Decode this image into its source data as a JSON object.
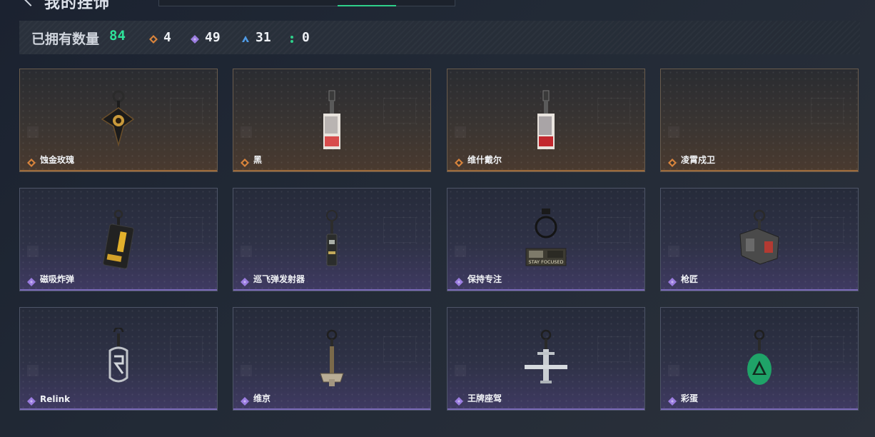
{
  "header": {
    "title": "我的挂饰"
  },
  "summary": {
    "owned_label": "已拥有数量",
    "owned_total": "84",
    "stats": [
      {
        "icon": "orange-diamond-icon",
        "color": "#d9843c",
        "count": "4"
      },
      {
        "icon": "purple-diamond-icon",
        "color": "#9b7de0",
        "count": "49"
      },
      {
        "icon": "blue-triangle-icon",
        "color": "#4f9be6",
        "count": "31"
      },
      {
        "icon": "green-dots-icon",
        "color": "#2fd08a",
        "count": "0"
      }
    ]
  },
  "colors": {
    "accent_green": "#2fd08a",
    "rarity_orange": "#d9843c",
    "rarity_purple": "#9b7de0"
  },
  "items": [
    {
      "name": "蚀金玫瑰",
      "rarity": "orange",
      "icon": "gold-rose-charm-icon"
    },
    {
      "name": "黑",
      "rarity": "orange",
      "icon": "black-card-charm-icon"
    },
    {
      "name": "维什戴尔",
      "rarity": "orange",
      "icon": "wisadel-card-charm-icon"
    },
    {
      "name": "凌霄戍卫",
      "rarity": "orange",
      "icon": "empty-slot-icon"
    },
    {
      "name": "磁吸炸弹",
      "rarity": "purple",
      "icon": "magnetic-bomb-charm-icon"
    },
    {
      "name": "巡飞弹发射器",
      "rarity": "purple",
      "icon": "loitering-launcher-charm-icon"
    },
    {
      "name": "保持专注",
      "rarity": "purple",
      "icon": "stay-focused-charm-icon"
    },
    {
      "name": "枪匠",
      "rarity": "purple",
      "icon": "gunsmith-charm-icon"
    },
    {
      "name": "Relink",
      "rarity": "purple",
      "icon": "relink-charm-icon"
    },
    {
      "name": "维京",
      "rarity": "purple",
      "icon": "viking-hammer-charm-icon"
    },
    {
      "name": "王牌座驾",
      "rarity": "purple",
      "icon": "ace-plane-charm-icon"
    },
    {
      "name": "彩蛋",
      "rarity": "purple",
      "icon": "easter-egg-charm-icon"
    }
  ],
  "art_text": {
    "stay_focused": "STAY FOCUSED"
  }
}
